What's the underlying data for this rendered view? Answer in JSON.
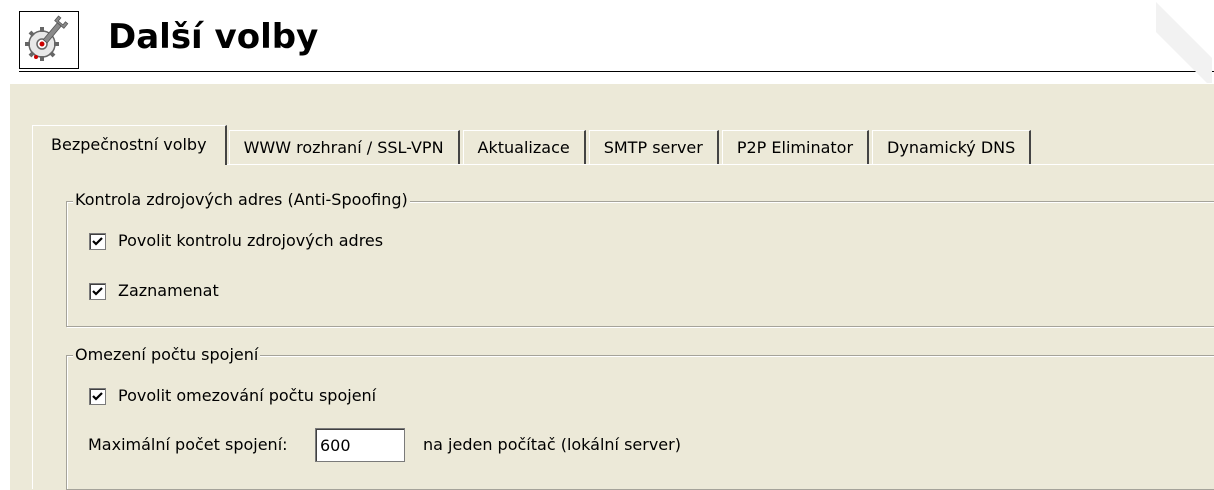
{
  "header": {
    "title": "Další volby",
    "icon": "gear-wrench-icon"
  },
  "tabs": [
    {
      "label": "Bezpečnostní volby",
      "active": true
    },
    {
      "label": "WWW rozhraní / SSL-VPN",
      "active": false
    },
    {
      "label": "Aktualizace",
      "active": false
    },
    {
      "label": "SMTP server",
      "active": false
    },
    {
      "label": "P2P Eliminator",
      "active": false
    },
    {
      "label": "Dynamický DNS",
      "active": false
    }
  ],
  "anti_spoofing": {
    "title": "Kontrola zdrojových adres (Anti-Spoofing)",
    "enable_check": {
      "label": "Povolit kontrolu zdrojových adres",
      "checked": true
    },
    "log_check": {
      "label": "Zaznamenat",
      "checked": true
    }
  },
  "connection_limit": {
    "title": "Omezení počtu spojení",
    "enable_check": {
      "label": "Povolit omezování počtu spojení",
      "checked": true
    },
    "max_label": "Maximální počet spojení:",
    "max_value": "600",
    "suffix": "na jeden počítač (lokální server)"
  },
  "colors": {
    "dialog_bg": "#ece9d8",
    "border_dark": "#a5a39a"
  }
}
